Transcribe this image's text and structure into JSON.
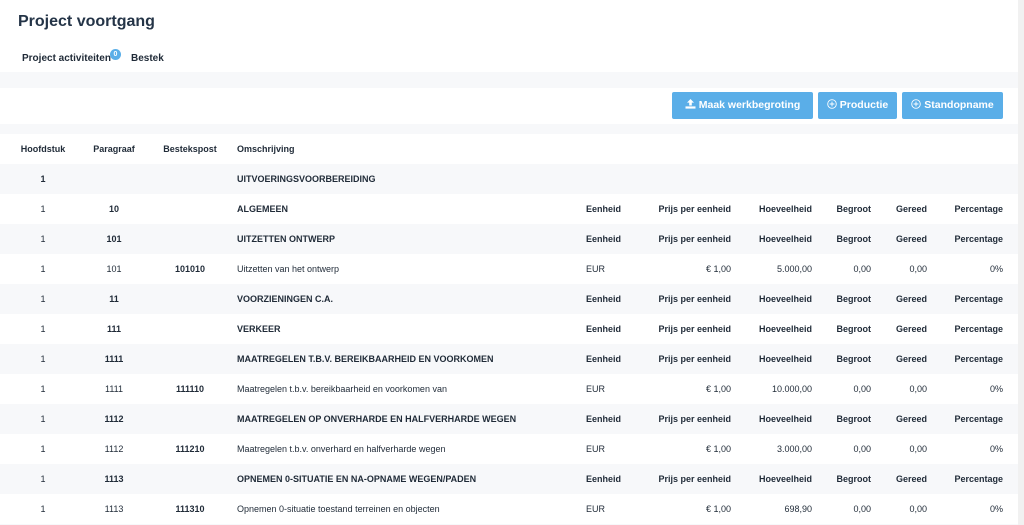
{
  "header": {
    "title": "Project voortgang"
  },
  "tabs": [
    {
      "label": "Project activiteiten",
      "badge": "0"
    },
    {
      "label": "Bestek"
    }
  ],
  "toolbar": {
    "werkbegroting_label": "Maak werkbegroting",
    "productie_label": "Productie",
    "standopname_label": "Standopname"
  },
  "table": {
    "columns": {
      "hoofdstuk": "Hoofdstuk",
      "paragraaf": "Paragraaf",
      "bestekspost": "Bestekspost",
      "omschrijving": "Omschrijving"
    },
    "group_columns": {
      "eenheid": "Eenheid",
      "prijs": "Prijs per eenheid",
      "hoeveelheid": "Hoeveelheid",
      "begroot": "Begroot",
      "gereed": "Gereed",
      "percentage": "Percentage"
    },
    "rows": [
      {
        "kind": "chapter",
        "hoofdstuk": "1",
        "omschrijving": "UITVOERINGSVOORBEREIDING"
      },
      {
        "kind": "group",
        "hoofdstuk": "1",
        "paragraaf": "10",
        "omschrijving": "ALGEMEEN"
      },
      {
        "kind": "group",
        "hoofdstuk": "1",
        "paragraaf": "101",
        "omschrijving": "UITZETTEN ONTWERP"
      },
      {
        "kind": "item",
        "hoofdstuk": "1",
        "paragraaf": "101",
        "bestekspost": "101010",
        "omschrijving": "Uitzetten van het ontwerp",
        "eenheid": "EUR",
        "prijs": "€ 1,00",
        "hoeveelheid": "5.000,00",
        "begroot": "0,00",
        "gereed": "0,00",
        "percentage": "0%"
      },
      {
        "kind": "group",
        "hoofdstuk": "1",
        "paragraaf": "11",
        "omschrijving": "VOORZIENINGEN C.A."
      },
      {
        "kind": "group",
        "hoofdstuk": "1",
        "paragraaf": "111",
        "omschrijving": "VERKEER"
      },
      {
        "kind": "group",
        "hoofdstuk": "1",
        "paragraaf": "1111",
        "omschrijving": "MAATREGELEN T.B.V. BEREIKBAARHEID EN VOORKOMEN"
      },
      {
        "kind": "item",
        "hoofdstuk": "1",
        "paragraaf": "1111",
        "bestekspost": "111110",
        "omschrijving": "Maatregelen t.b.v. bereikbaarheid en voorkomen van",
        "eenheid": "EUR",
        "prijs": "€ 1,00",
        "hoeveelheid": "10.000,00",
        "begroot": "0,00",
        "gereed": "0,00",
        "percentage": "0%"
      },
      {
        "kind": "group",
        "hoofdstuk": "1",
        "paragraaf": "1112",
        "omschrijving": "MAATREGELEN OP ONVERHARDE EN HALFVERHARDE WEGEN"
      },
      {
        "kind": "item",
        "hoofdstuk": "1",
        "paragraaf": "1112",
        "bestekspost": "111210",
        "omschrijving": "Maatregelen t.b.v. onverhard en halfverharde wegen",
        "eenheid": "EUR",
        "prijs": "€ 1,00",
        "hoeveelheid": "3.000,00",
        "begroot": "0,00",
        "gereed": "0,00",
        "percentage": "0%"
      },
      {
        "kind": "group",
        "hoofdstuk": "1",
        "paragraaf": "1113",
        "omschrijving": "OPNEMEN 0-SITUATIE EN NA-OPNAME WEGEN/PADEN"
      },
      {
        "kind": "item",
        "hoofdstuk": "1",
        "paragraaf": "1113",
        "bestekspost": "111310",
        "omschrijving": "Opnemen 0-situatie toestand terreinen en objecten",
        "eenheid": "EUR",
        "prijs": "€ 1,00",
        "hoeveelheid": "698,90",
        "begroot": "0,00",
        "gereed": "0,00",
        "percentage": "0%"
      }
    ]
  }
}
